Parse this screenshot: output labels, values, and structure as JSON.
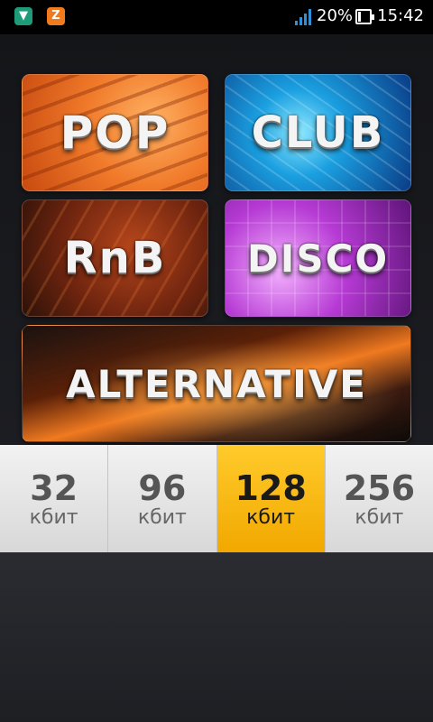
{
  "status_bar": {
    "notification_icons": [
      "shield-icon",
      "z-app-icon"
    ],
    "battery_percent": "20%",
    "battery_level": 0.2,
    "time": "15:42"
  },
  "genres": [
    {
      "label": "POP",
      "color": "#f07a2a"
    },
    {
      "label": "CLUB",
      "color": "#1a9fe0"
    },
    {
      "label": "RnB",
      "color": "#6e240f"
    },
    {
      "label": "DISCO",
      "color": "#b63ad4"
    },
    {
      "label": "ALTERNATIVE",
      "color": "#f07a20"
    }
  ],
  "bitrates": [
    {
      "value": "32",
      "unit": "кбит",
      "selected": false
    },
    {
      "value": "96",
      "unit": "кбит",
      "selected": false
    },
    {
      "value": "128",
      "unit": "кбит",
      "selected": true
    },
    {
      "value": "256",
      "unit": "кбит",
      "selected": false
    }
  ],
  "accent_color": "#f7b500"
}
